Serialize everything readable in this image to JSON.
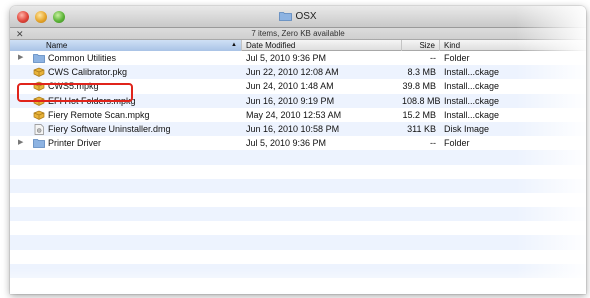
{
  "window": {
    "title": "OSX"
  },
  "status": {
    "text": "7 items, Zero KB available"
  },
  "columns": {
    "name": "Name",
    "date": "Date Modified",
    "size": "Size",
    "kind": "Kind"
  },
  "rows": [
    {
      "name": "Common Utilities",
      "date": "Jul 5, 2010 9:36 PM",
      "size": "--",
      "kind": "Folder",
      "icon": "folder-icon"
    },
    {
      "name": "CWS Calibrator.pkg",
      "date": "Jun 22, 2010 12:08 AM",
      "size": "8.3 MB",
      "kind": "Install...ckage",
      "icon": "package-icon"
    },
    {
      "name": "CWS5.mpkg",
      "date": "Jun 24, 2010 1:48 AM",
      "size": "39.8 MB",
      "kind": "Install...ckage",
      "icon": "package-icon"
    },
    {
      "name": "EFI Hot Folders.mpkg",
      "date": "Jun 16, 2010 9:19 PM",
      "size": "108.8 MB",
      "kind": "Install...ckage",
      "icon": "package-icon"
    },
    {
      "name": "Fiery Remote Scan.mpkg",
      "date": "May 24, 2010 12:53 AM",
      "size": "15.2 MB",
      "kind": "Install...ckage",
      "icon": "package-icon"
    },
    {
      "name": "Fiery Software Uninstaller.dmg",
      "date": "Jun 16, 2010 10:58 PM",
      "size": "311 KB",
      "kind": "Disk Image",
      "icon": "disk-image-icon"
    },
    {
      "name": "Printer Driver",
      "date": "Jul 5, 2010 9:36 PM",
      "size": "--",
      "kind": "Folder",
      "icon": "folder-icon"
    }
  ],
  "colors": {
    "highlight": "#e0241b",
    "alt_row": "#edf3fe",
    "folder": "#7fa9dc"
  }
}
